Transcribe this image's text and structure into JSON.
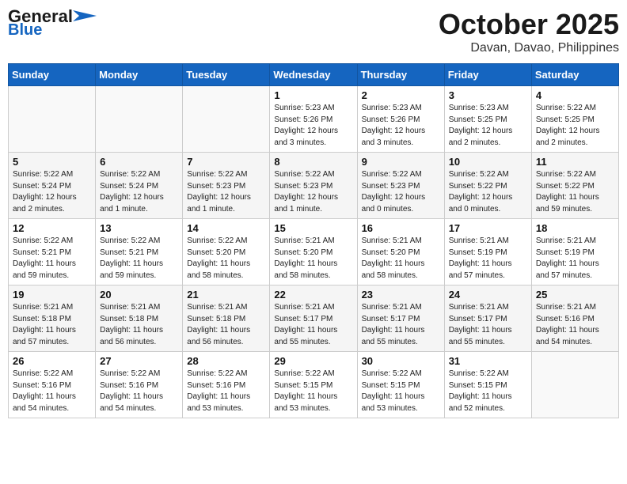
{
  "header": {
    "logo_general": "General",
    "logo_blue": "Blue",
    "month_title": "October 2025",
    "location": "Davan, Davao, Philippines"
  },
  "days_of_week": [
    "Sunday",
    "Monday",
    "Tuesday",
    "Wednesday",
    "Thursday",
    "Friday",
    "Saturday"
  ],
  "weeks": [
    [
      {
        "day": "",
        "info": ""
      },
      {
        "day": "",
        "info": ""
      },
      {
        "day": "",
        "info": ""
      },
      {
        "day": "1",
        "info": "Sunrise: 5:23 AM\nSunset: 5:26 PM\nDaylight: 12 hours\nand 3 minutes."
      },
      {
        "day": "2",
        "info": "Sunrise: 5:23 AM\nSunset: 5:26 PM\nDaylight: 12 hours\nand 3 minutes."
      },
      {
        "day": "3",
        "info": "Sunrise: 5:23 AM\nSunset: 5:25 PM\nDaylight: 12 hours\nand 2 minutes."
      },
      {
        "day": "4",
        "info": "Sunrise: 5:22 AM\nSunset: 5:25 PM\nDaylight: 12 hours\nand 2 minutes."
      }
    ],
    [
      {
        "day": "5",
        "info": "Sunrise: 5:22 AM\nSunset: 5:24 PM\nDaylight: 12 hours\nand 2 minutes."
      },
      {
        "day": "6",
        "info": "Sunrise: 5:22 AM\nSunset: 5:24 PM\nDaylight: 12 hours\nand 1 minute."
      },
      {
        "day": "7",
        "info": "Sunrise: 5:22 AM\nSunset: 5:23 PM\nDaylight: 12 hours\nand 1 minute."
      },
      {
        "day": "8",
        "info": "Sunrise: 5:22 AM\nSunset: 5:23 PM\nDaylight: 12 hours\nand 1 minute."
      },
      {
        "day": "9",
        "info": "Sunrise: 5:22 AM\nSunset: 5:23 PM\nDaylight: 12 hours\nand 0 minutes."
      },
      {
        "day": "10",
        "info": "Sunrise: 5:22 AM\nSunset: 5:22 PM\nDaylight: 12 hours\nand 0 minutes."
      },
      {
        "day": "11",
        "info": "Sunrise: 5:22 AM\nSunset: 5:22 PM\nDaylight: 11 hours\nand 59 minutes."
      }
    ],
    [
      {
        "day": "12",
        "info": "Sunrise: 5:22 AM\nSunset: 5:21 PM\nDaylight: 11 hours\nand 59 minutes."
      },
      {
        "day": "13",
        "info": "Sunrise: 5:22 AM\nSunset: 5:21 PM\nDaylight: 11 hours\nand 59 minutes."
      },
      {
        "day": "14",
        "info": "Sunrise: 5:22 AM\nSunset: 5:20 PM\nDaylight: 11 hours\nand 58 minutes."
      },
      {
        "day": "15",
        "info": "Sunrise: 5:21 AM\nSunset: 5:20 PM\nDaylight: 11 hours\nand 58 minutes."
      },
      {
        "day": "16",
        "info": "Sunrise: 5:21 AM\nSunset: 5:20 PM\nDaylight: 11 hours\nand 58 minutes."
      },
      {
        "day": "17",
        "info": "Sunrise: 5:21 AM\nSunset: 5:19 PM\nDaylight: 11 hours\nand 57 minutes."
      },
      {
        "day": "18",
        "info": "Sunrise: 5:21 AM\nSunset: 5:19 PM\nDaylight: 11 hours\nand 57 minutes."
      }
    ],
    [
      {
        "day": "19",
        "info": "Sunrise: 5:21 AM\nSunset: 5:18 PM\nDaylight: 11 hours\nand 57 minutes."
      },
      {
        "day": "20",
        "info": "Sunrise: 5:21 AM\nSunset: 5:18 PM\nDaylight: 11 hours\nand 56 minutes."
      },
      {
        "day": "21",
        "info": "Sunrise: 5:21 AM\nSunset: 5:18 PM\nDaylight: 11 hours\nand 56 minutes."
      },
      {
        "day": "22",
        "info": "Sunrise: 5:21 AM\nSunset: 5:17 PM\nDaylight: 11 hours\nand 55 minutes."
      },
      {
        "day": "23",
        "info": "Sunrise: 5:21 AM\nSunset: 5:17 PM\nDaylight: 11 hours\nand 55 minutes."
      },
      {
        "day": "24",
        "info": "Sunrise: 5:21 AM\nSunset: 5:17 PM\nDaylight: 11 hours\nand 55 minutes."
      },
      {
        "day": "25",
        "info": "Sunrise: 5:21 AM\nSunset: 5:16 PM\nDaylight: 11 hours\nand 54 minutes."
      }
    ],
    [
      {
        "day": "26",
        "info": "Sunrise: 5:22 AM\nSunset: 5:16 PM\nDaylight: 11 hours\nand 54 minutes."
      },
      {
        "day": "27",
        "info": "Sunrise: 5:22 AM\nSunset: 5:16 PM\nDaylight: 11 hours\nand 54 minutes."
      },
      {
        "day": "28",
        "info": "Sunrise: 5:22 AM\nSunset: 5:16 PM\nDaylight: 11 hours\nand 53 minutes."
      },
      {
        "day": "29",
        "info": "Sunrise: 5:22 AM\nSunset: 5:15 PM\nDaylight: 11 hours\nand 53 minutes."
      },
      {
        "day": "30",
        "info": "Sunrise: 5:22 AM\nSunset: 5:15 PM\nDaylight: 11 hours\nand 53 minutes."
      },
      {
        "day": "31",
        "info": "Sunrise: 5:22 AM\nSunset: 5:15 PM\nDaylight: 11 hours\nand 52 minutes."
      },
      {
        "day": "",
        "info": ""
      }
    ]
  ]
}
